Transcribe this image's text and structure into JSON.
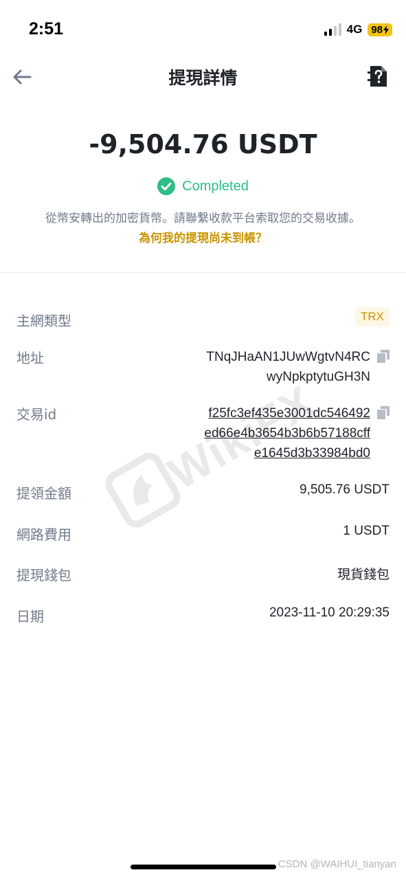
{
  "status_bar": {
    "time": "2:51",
    "network": "4G",
    "battery": "98"
  },
  "nav": {
    "title": "提現詳情"
  },
  "summary": {
    "amount": "-9,504.76 USDT",
    "status": "Completed",
    "notice": "從幣安轉出的加密貨幣。請聯繫收款平台索取您的交易收據。",
    "why_link": "為何我的提現尚未到帳？"
  },
  "details": {
    "network_type": {
      "label": "主網類型",
      "value": "TRX"
    },
    "address": {
      "label": "地址",
      "lines": [
        "TNqJHaAN1JUwWgtvN4RC",
        "wyNpkptytuGH3N"
      ]
    },
    "txid": {
      "label": "交易id",
      "lines": [
        "f25fc3ef435e3001dc546492",
        "ed66e4b3654b3b6b57188cff",
        "e1645d3b33984bd0"
      ]
    },
    "amount": {
      "label": "提領金額",
      "value": "9,505.76 USDT"
    },
    "fee": {
      "label": "網路費用",
      "value": "1 USDT"
    },
    "wallet": {
      "label": "提現錢包",
      "value": "現貨錢包"
    },
    "date": {
      "label": "日期",
      "value": "2023-11-10 20:29:35"
    }
  },
  "watermark": {
    "text": "WikiFX"
  },
  "footer": {
    "credit": "CSDN @WAIHUI_tianyan"
  },
  "colors": {
    "success": "#2ebd85",
    "accent": "#c99400",
    "label": "#707a8a",
    "text": "#1e2329"
  },
  "icons": {
    "back": "back-arrow-icon",
    "help": "help-document-icon",
    "status": "check-circle-icon",
    "copy": "copy-icon"
  }
}
